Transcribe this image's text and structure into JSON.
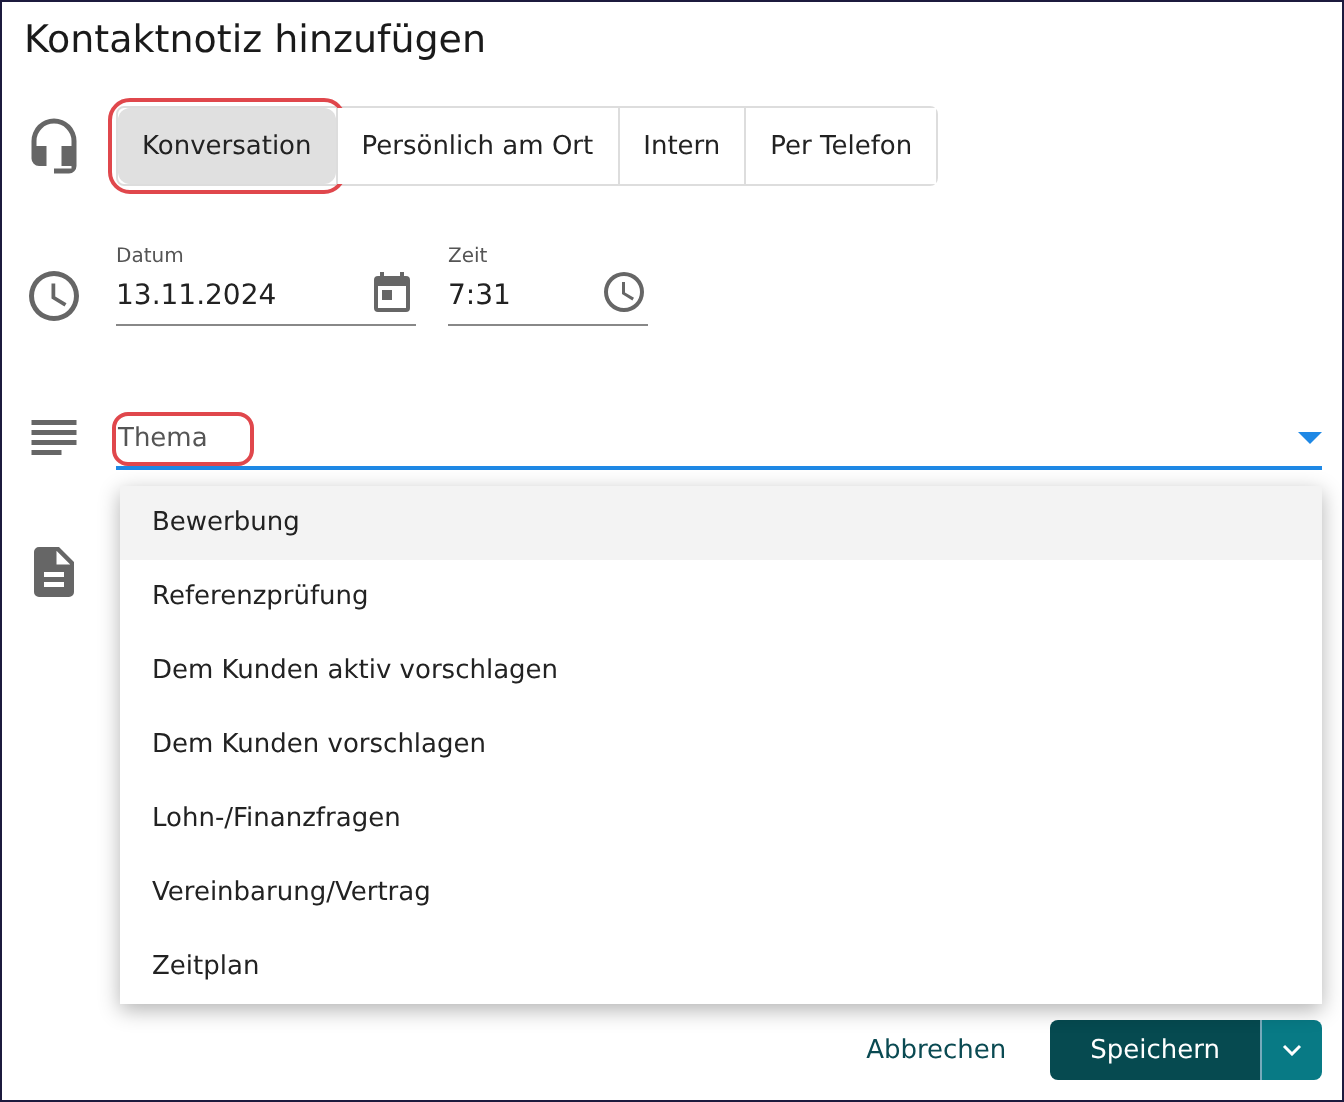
{
  "dialog": {
    "title": "Kontaktnotiz hinzufügen"
  },
  "contact_types": [
    {
      "label": "Konversation",
      "selected": true,
      "highlighted": true
    },
    {
      "label": "Persönlich am Ort",
      "selected": false,
      "highlighted": false
    },
    {
      "label": "Intern",
      "selected": false,
      "highlighted": false
    },
    {
      "label": "Per Telefon",
      "selected": false,
      "highlighted": false
    }
  ],
  "date_field": {
    "label": "Datum",
    "value": "13.11.2024"
  },
  "time_field": {
    "label": "Zeit",
    "value": "7:31"
  },
  "topic_field": {
    "placeholder": "Thema",
    "highlighted": true,
    "expanded": true
  },
  "topic_options": [
    {
      "label": "Bewerbung",
      "selected": true
    },
    {
      "label": "Referenzprüfung",
      "selected": false
    },
    {
      "label": "Dem Kunden aktiv vorschlagen",
      "selected": false
    },
    {
      "label": "Dem Kunden vorschlagen",
      "selected": false
    },
    {
      "label": "Lohn-/Finanzfragen",
      "selected": false
    },
    {
      "label": "Vereinbarung/Vertrag",
      "selected": false
    },
    {
      "label": "Zeitplan",
      "selected": false
    }
  ],
  "buttons": {
    "cancel": "Abbrechen",
    "save": "Speichern"
  }
}
